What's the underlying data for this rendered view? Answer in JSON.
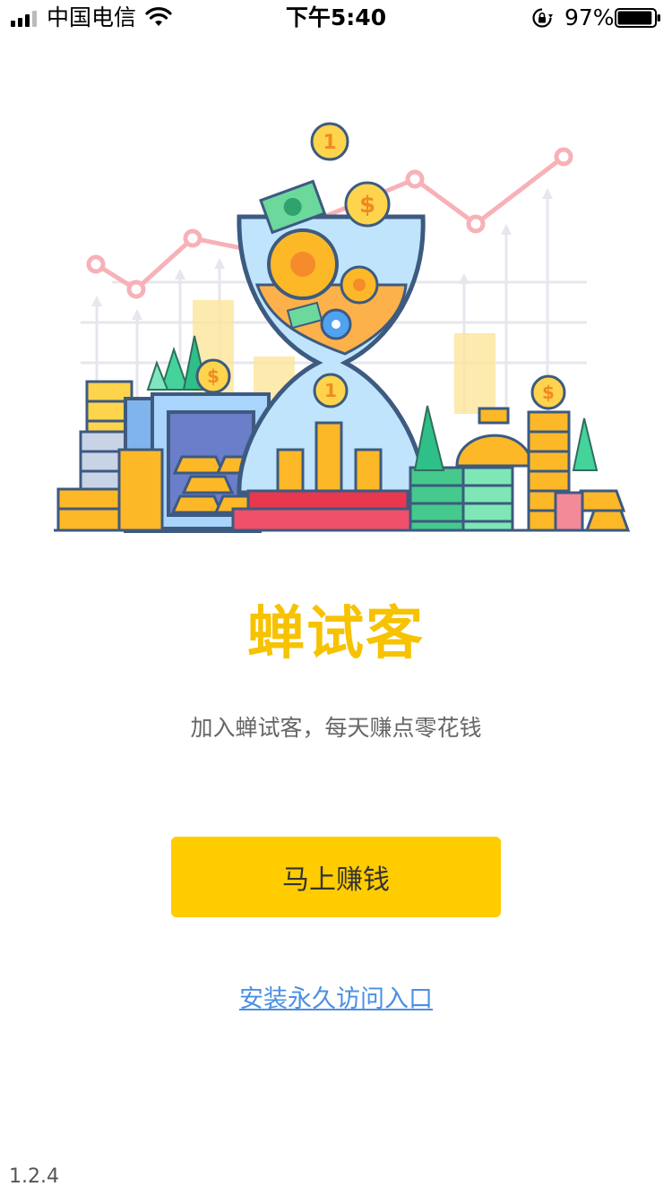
{
  "status_bar": {
    "carrier": "中国电信",
    "time": "下午5:40",
    "battery_percent": "97%",
    "battery_level": 0.97
  },
  "app": {
    "title": "蝉试客",
    "tagline": "加入蝉试客，每天赚点零花钱",
    "cta_label": "马上赚钱",
    "install_link": "安装永久访问入口",
    "version": "1.2.4"
  },
  "hero": {
    "top_coin_text": "1",
    "mid_coin_text": "1",
    "dollar_symbol": "$"
  },
  "colors": {
    "accent": "#ffcc00",
    "title": "#f7c200",
    "link": "#4a90e2"
  }
}
